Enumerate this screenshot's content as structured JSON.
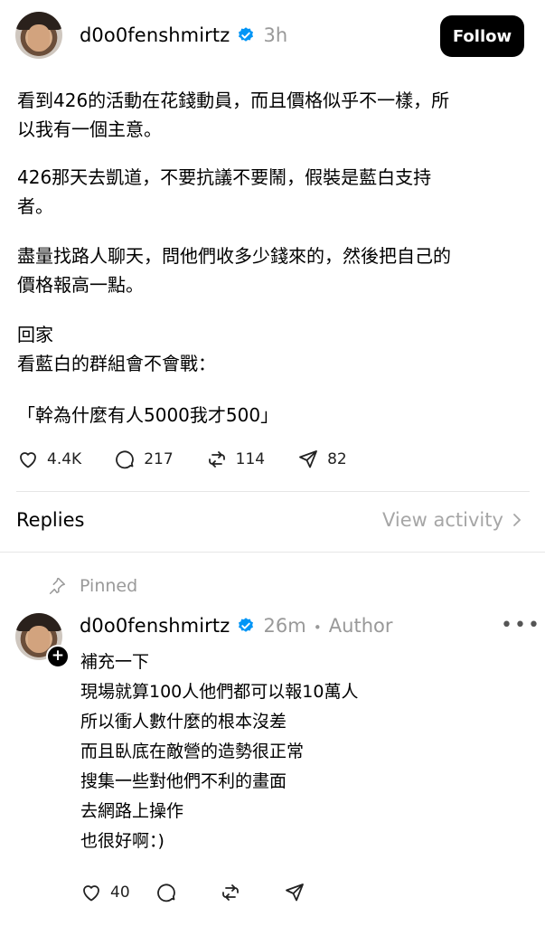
{
  "post": {
    "username": "d0o0fenshmirtz",
    "time": "3h",
    "follow_label": "Follow",
    "paragraphs": [
      "看到426的活動在花錢動員，而且價格似乎不一樣，所\n以我有一個主意。",
      "426那天去凱道，不要抗議不要鬧，假裝是藍白支持\n者。",
      "盡量找路人聊天，問他們收多少錢來的，然後把自己的\n價格報高一點。",
      "回家\n看藍白的群組會不會戰：",
      "「幹為什麼有人5000我才500」"
    ],
    "likes": "4.4K",
    "comments": "217",
    "reposts": "114",
    "shares": "82"
  },
  "replies_header": {
    "label": "Replies",
    "view_activity": "View activity"
  },
  "reply": {
    "pinned_label": "Pinned",
    "username": "d0o0fenshmirtz",
    "time": "26m",
    "separator": "•",
    "author_label": "Author",
    "more": "•••",
    "text": "補充一下\n現場就算100人他們都可以報10萬人\n所以衝人數什麼的根本沒差\n而且臥底在敵營的造勢很正常\n搜集一些對他們不利的畫面\n去網路上操作\n也很好啊：)",
    "likes": "40"
  },
  "colors": {
    "verified_blue": "#0095f6",
    "muted": "#999999",
    "button_bg": "#000000"
  },
  "icons": [
    "heart-icon",
    "comment-icon",
    "repost-icon",
    "share-icon",
    "pin-icon",
    "verified-icon",
    "chevron-right-icon",
    "plus-icon"
  ]
}
